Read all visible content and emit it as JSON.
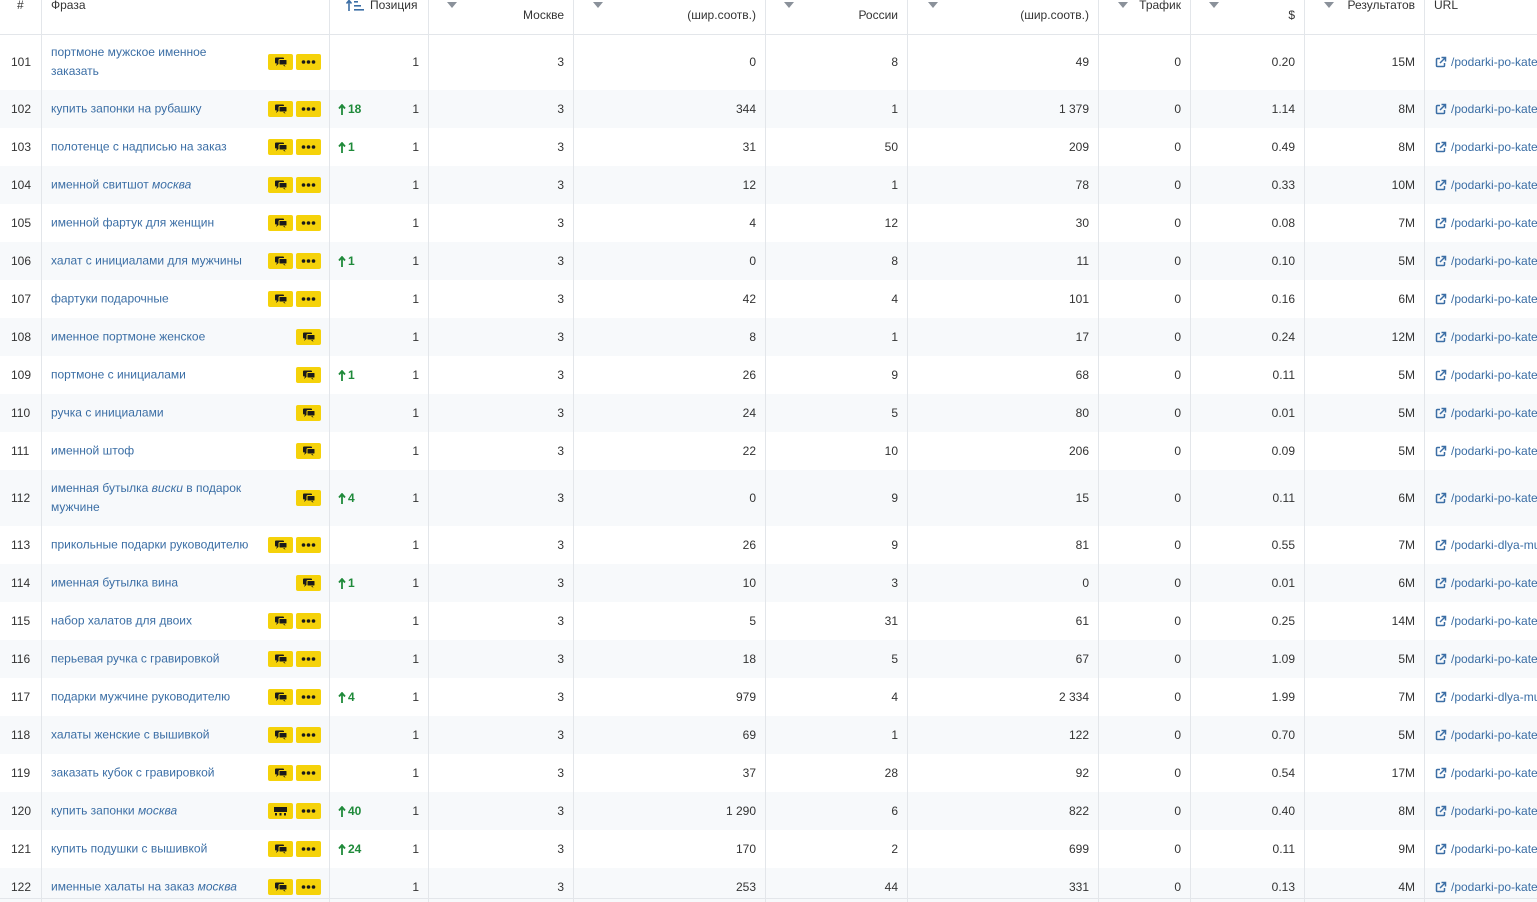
{
  "header": {
    "index": "#",
    "phrase": "Фраза",
    "position": "Позиция",
    "moscow": "Москве",
    "moscow_broad": "(шир.соотв.)",
    "russia": "России",
    "russia_broad": "(шир.соотв.)",
    "traffic": "Трафик",
    "cost_unit": "$",
    "results": "Результатов",
    "url": "URL"
  },
  "colors": {
    "accent": "#3b6ea5",
    "badge": "#f5d20a",
    "up": "#1f8a3a",
    "grid": "#e3e6ea"
  },
  "icons": {
    "sort": "sort-ascending-icon",
    "filter": "filter-caret-icon",
    "chat": "chat-bubbles-icon",
    "more": "more-dots-icon",
    "pics": "image-strip-icon",
    "up": "arrow-up-icon",
    "link": "external-link-icon"
  },
  "rows": [
    {
      "n": "101",
      "phrase": [
        "портмоне мужское именное",
        "заказать"
      ],
      "italic": "",
      "btns": "chat,more",
      "delta": "",
      "pos": "1",
      "m": "3",
      "mb": "0",
      "r": "8",
      "rb": "49",
      "t": "0",
      "c": "0.20",
      "res": "15M",
      "url": "/podarki-po-kate"
    },
    {
      "n": "102",
      "phrase": [
        "купить запонки на рубашку"
      ],
      "italic": "",
      "btns": "chat,more",
      "delta": "18",
      "pos": "1",
      "m": "3",
      "mb": "344",
      "r": "1",
      "rb": "1 379",
      "t": "0",
      "c": "1.14",
      "res": "8M",
      "url": "/podarki-po-kate"
    },
    {
      "n": "103",
      "phrase": [
        "полотенце с надписью на заказ"
      ],
      "italic": "",
      "btns": "chat,more",
      "delta": "1",
      "pos": "1",
      "m": "3",
      "mb": "31",
      "r": "50",
      "rb": "209",
      "t": "0",
      "c": "0.49",
      "res": "8M",
      "url": "/podarki-po-kate"
    },
    {
      "n": "104",
      "phrase": [
        "именной свитшот "
      ],
      "italic": "москва",
      "btns": "chat,more",
      "delta": "",
      "pos": "1",
      "m": "3",
      "mb": "12",
      "r": "1",
      "rb": "78",
      "t": "0",
      "c": "0.33",
      "res": "10M",
      "url": "/podarki-po-kate"
    },
    {
      "n": "105",
      "phrase": [
        "именной фартук для женщин"
      ],
      "italic": "",
      "btns": "chat,more",
      "delta": "",
      "pos": "1",
      "m": "3",
      "mb": "4",
      "r": "12",
      "rb": "30",
      "t": "0",
      "c": "0.08",
      "res": "7M",
      "url": "/podarki-po-kate"
    },
    {
      "n": "106",
      "phrase": [
        "халат с инициалами для мужчины"
      ],
      "italic": "",
      "btns": "chat,more",
      "delta": "1",
      "pos": "1",
      "m": "3",
      "mb": "0",
      "r": "8",
      "rb": "11",
      "t": "0",
      "c": "0.10",
      "res": "5M",
      "url": "/podarki-po-kate"
    },
    {
      "n": "107",
      "phrase": [
        "фартуки подарочные"
      ],
      "italic": "",
      "btns": "chat,more",
      "delta": "",
      "pos": "1",
      "m": "3",
      "mb": "42",
      "r": "4",
      "rb": "101",
      "t": "0",
      "c": "0.16",
      "res": "6M",
      "url": "/podarki-po-kate"
    },
    {
      "n": "108",
      "phrase": [
        "именное портмоне женское"
      ],
      "italic": "",
      "btns": "chat",
      "delta": "",
      "pos": "1",
      "m": "3",
      "mb": "8",
      "r": "1",
      "rb": "17",
      "t": "0",
      "c": "0.24",
      "res": "12M",
      "url": "/podarki-po-kate"
    },
    {
      "n": "109",
      "phrase": [
        "портмоне с инициалами"
      ],
      "italic": "",
      "btns": "chat",
      "delta": "1",
      "pos": "1",
      "m": "3",
      "mb": "26",
      "r": "9",
      "rb": "68",
      "t": "0",
      "c": "0.11",
      "res": "5M",
      "url": "/podarki-po-kate"
    },
    {
      "n": "110",
      "phrase": [
        "ручка с инициалами"
      ],
      "italic": "",
      "btns": "chat",
      "delta": "",
      "pos": "1",
      "m": "3",
      "mb": "24",
      "r": "5",
      "rb": "80",
      "t": "0",
      "c": "0.01",
      "res": "5M",
      "url": "/podarki-po-kate"
    },
    {
      "n": "111",
      "phrase": [
        "именной штоф"
      ],
      "italic": "",
      "btns": "chat",
      "delta": "",
      "pos": "1",
      "m": "3",
      "mb": "22",
      "r": "10",
      "rb": "206",
      "t": "0",
      "c": "0.09",
      "res": "5M",
      "url": "/podarki-po-kate"
    },
    {
      "n": "112",
      "phrase": [
        "именная бутылка ",
        "виски",
        " в подарок",
        "мужчине"
      ],
      "italic": "",
      "btns": "chat",
      "delta": "4",
      "pos": "1",
      "m": "3",
      "mb": "0",
      "r": "9",
      "rb": "15",
      "t": "0",
      "c": "0.11",
      "res": "6M",
      "url": "/podarki-po-kate"
    },
    {
      "n": "113",
      "phrase": [
        "прикольные подарки руководителю"
      ],
      "italic": "",
      "btns": "chat,more",
      "delta": "",
      "pos": "1",
      "m": "3",
      "mb": "26",
      "r": "9",
      "rb": "81",
      "t": "0",
      "c": "0.55",
      "res": "7M",
      "url": "/podarki-dlya-mu"
    },
    {
      "n": "114",
      "phrase": [
        "именная бутылка вина"
      ],
      "italic": "",
      "btns": "chat",
      "delta": "1",
      "pos": "1",
      "m": "3",
      "mb": "10",
      "r": "3",
      "rb": "0",
      "t": "0",
      "c": "0.01",
      "res": "6M",
      "url": "/podarki-po-kate"
    },
    {
      "n": "115",
      "phrase": [
        "набор халатов для двоих"
      ],
      "italic": "",
      "btns": "chat,more",
      "delta": "",
      "pos": "1",
      "m": "3",
      "mb": "5",
      "r": "31",
      "rb": "61",
      "t": "0",
      "c": "0.25",
      "res": "14M",
      "url": "/podarki-po-kate"
    },
    {
      "n": "116",
      "phrase": [
        "перьевая ручка с гравировкой"
      ],
      "italic": "",
      "btns": "chat,more",
      "delta": "",
      "pos": "1",
      "m": "3",
      "mb": "18",
      "r": "5",
      "rb": "67",
      "t": "0",
      "c": "1.09",
      "res": "5M",
      "url": "/podarki-po-kate"
    },
    {
      "n": "117",
      "phrase": [
        "подарки мужчине руководителю"
      ],
      "italic": "",
      "btns": "chat,more",
      "delta": "4",
      "pos": "1",
      "m": "3",
      "mb": "979",
      "r": "4",
      "rb": "2 334",
      "t": "0",
      "c": "1.99",
      "res": "7M",
      "url": "/podarki-dlya-mu"
    },
    {
      "n": "118",
      "phrase": [
        "халаты женские с вышивкой"
      ],
      "italic": "",
      "btns": "chat,more",
      "delta": "",
      "pos": "1",
      "m": "3",
      "mb": "69",
      "r": "1",
      "rb": "122",
      "t": "0",
      "c": "0.70",
      "res": "5M",
      "url": "/podarki-po-kate"
    },
    {
      "n": "119",
      "phrase": [
        "заказать кубок с гравировкой"
      ],
      "italic": "",
      "btns": "chat,more",
      "delta": "",
      "pos": "1",
      "m": "3",
      "mb": "37",
      "r": "28",
      "rb": "92",
      "t": "0",
      "c": "0.54",
      "res": "17M",
      "url": "/podarki-po-kate"
    },
    {
      "n": "120",
      "phrase": [
        "купить запонки "
      ],
      "italic": "москва",
      "btns": "pics,more",
      "delta": "40",
      "pos": "1",
      "m": "3",
      "mb": "1 290",
      "r": "6",
      "rb": "822",
      "t": "0",
      "c": "0.40",
      "res": "8M",
      "url": "/podarki-po-kate"
    },
    {
      "n": "121",
      "phrase": [
        "купить подушки с вышивкой"
      ],
      "italic": "",
      "btns": "chat,more",
      "delta": "24",
      "pos": "1",
      "m": "3",
      "mb": "170",
      "r": "2",
      "rb": "699",
      "t": "0",
      "c": "0.11",
      "res": "9M",
      "url": "/podarki-po-kate"
    },
    {
      "n": "122",
      "phrase": [
        "именные халаты на заказ "
      ],
      "italic": "москва",
      "btns": "chat,more",
      "delta": "",
      "pos": "1",
      "m": "3",
      "mb": "253",
      "r": "44",
      "rb": "331",
      "t": "0",
      "c": "0.13",
      "res": "4M",
      "url": "/podarki-po-kate"
    }
  ]
}
